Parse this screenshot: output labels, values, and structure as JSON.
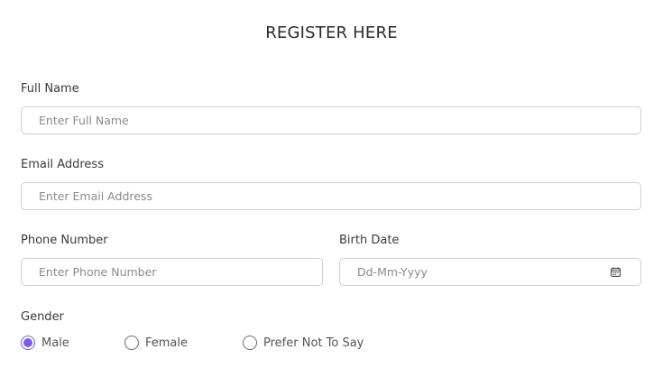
{
  "form": {
    "title": "REGISTER HERE",
    "full_name": {
      "label": "Full Name",
      "placeholder": "Enter Full Name",
      "value": ""
    },
    "email": {
      "label": "Email Address",
      "placeholder": "Enter Email Address",
      "value": ""
    },
    "phone": {
      "label": "Phone Number",
      "placeholder": "Enter Phone Number",
      "value": ""
    },
    "birth_date": {
      "label": "Birth Date",
      "placeholder": "Dd-Mm-Yyyy",
      "value": "",
      "icon": "calendar-icon"
    },
    "gender": {
      "label": "Gender",
      "options": [
        "Male",
        "Female",
        "Prefer Not To Say"
      ],
      "selected": "Male"
    }
  },
  "colors": {
    "accent": "#7a5ce5",
    "border": "#cfcfcf",
    "placeholder": "#8a8a8a",
    "text": "#333333"
  }
}
